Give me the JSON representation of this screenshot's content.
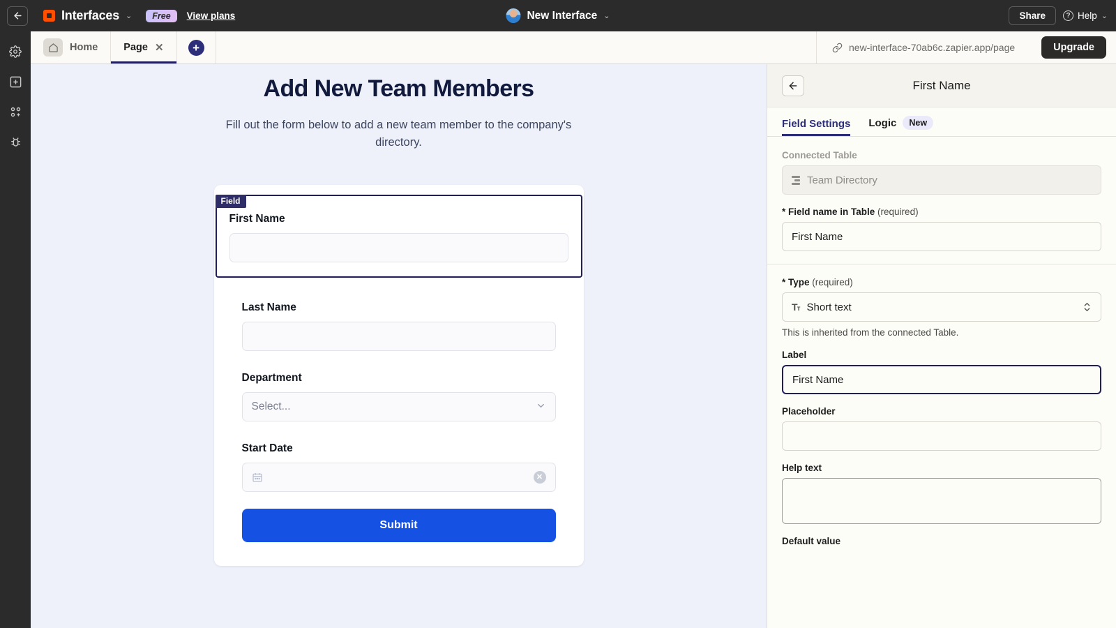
{
  "topbar": {
    "back_icon": "arrow-left-icon",
    "brand_name": "Interfaces",
    "brand_caret": "⌄",
    "plan_badge": "Free",
    "view_plans": "View plans",
    "interface_name": "New Interface",
    "interface_caret": "⌄",
    "share_label": "Share",
    "help_label": "Help",
    "help_caret": "⌄"
  },
  "rail": {
    "items": [
      {
        "name": "settings-gear-icon"
      },
      {
        "name": "add-box-icon"
      },
      {
        "name": "apps-grid-icon"
      },
      {
        "name": "bug-icon"
      }
    ]
  },
  "tabbar": {
    "tabs": [
      {
        "label": "Home",
        "icon": "home-icon",
        "active": false,
        "closable": false
      },
      {
        "label": "Page",
        "icon": "",
        "active": true,
        "closable": true
      }
    ],
    "close_glyph": "✕",
    "add_tab_glyph": "+",
    "url": "new-interface-70ab6c.zapier.app/page",
    "link_icon": "link-icon",
    "upgrade_label": "Upgrade"
  },
  "canvas": {
    "title": "Add New Team Members",
    "subtitle": "Fill out the form below to add a new team member to the company's directory.",
    "selected_badge": "Field",
    "fields": [
      {
        "label": "First Name",
        "value": "",
        "placeholder": "",
        "type": "text",
        "selected": true
      },
      {
        "label": "Last Name",
        "value": "",
        "placeholder": "",
        "type": "text",
        "selected": false
      },
      {
        "label": "Department",
        "value": "",
        "placeholder": "Select...",
        "type": "select",
        "selected": false
      },
      {
        "label": "Start Date",
        "value": "",
        "placeholder": "",
        "type": "date",
        "selected": false
      }
    ],
    "select_caret": "⌄",
    "date_icon": "calendar-icon",
    "clear_glyph": "✕",
    "submit_label": "Submit"
  },
  "panel": {
    "back_icon": "arrow-left-icon",
    "title": "First Name",
    "tabs": [
      {
        "label": "Field Settings",
        "badge": "",
        "active": true
      },
      {
        "label": "Logic",
        "badge": "New",
        "active": false
      }
    ],
    "connected_table_label": "Connected Table",
    "connected_table_value": "Team Directory",
    "connected_table_icon": "table-icon",
    "field_name_label": "* Field name in Table",
    "field_name_required": "(required)",
    "field_name_value": "First Name",
    "type_label": "* Type",
    "type_required": "(required)",
    "type_value": "Short text",
    "type_icon": "text-format-icon",
    "type_hint": "This is inherited from the connected Table.",
    "label_label": "Label",
    "label_value": "First Name",
    "placeholder_label": "Placeholder",
    "placeholder_value": "",
    "help_text_label": "Help text",
    "help_text_value": "",
    "default_value_label": "Default value"
  },
  "colors": {
    "accent_blue": "#1552e3",
    "brand_orange": "#ff4f00",
    "indigo": "#2d2e7a",
    "canvas_bg": "#eef1fa",
    "panel_bg": "#fdfdf8",
    "topbar_bg": "#2b2b2b"
  }
}
